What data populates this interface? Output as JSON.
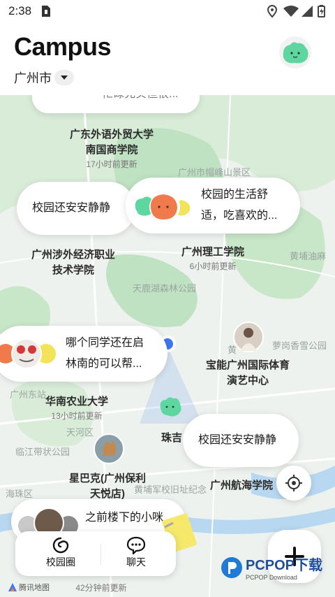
{
  "status": {
    "time": "2:38"
  },
  "header": {
    "title": "Campus",
    "city": "广州市"
  },
  "map": {
    "labels": [
      {
        "name": "area-label-baiyunshan",
        "text": "广州市帽峰山景区"
      },
      {
        "name": "area-label-huangpu",
        "text": "黄埔油麻"
      },
      {
        "name": "area-label-tianlu",
        "text": "天鹿湖森林公园"
      },
      {
        "name": "area-label-luogang",
        "text": "萝岗香雪公园"
      },
      {
        "name": "area-label-huangpu2",
        "text": "黄"
      },
      {
        "name": "area-label-dongzhan",
        "text": "广州东站"
      },
      {
        "name": "area-label-tianhe",
        "text": "天河区"
      },
      {
        "name": "area-label-linjiang",
        "text": "临江带状公园"
      },
      {
        "name": "area-label-haizhu",
        "text": "海珠区"
      },
      {
        "name": "area-label-huangpu-school",
        "text": "黄埔军校旧址纪念"
      }
    ],
    "schools": [
      {
        "name": "school-gdufs",
        "line1": "广东外语外贸大学",
        "line2": "南国商学院",
        "updated": "17小时前更新"
      },
      {
        "name": "school-gzist",
        "line1": "广州涉外经济职业",
        "line2": "技术学院",
        "updated": ""
      },
      {
        "name": "school-gzit",
        "line1": "广州理工学院",
        "line2": "",
        "updated": "6小时前更新"
      },
      {
        "name": "school-baoneng",
        "line1": "宝能广州国际体育",
        "line2": "演艺中心",
        "updated": ""
      },
      {
        "name": "school-scau",
        "line1": "华南农业大学",
        "line2": "",
        "updated": "13小时前更新"
      },
      {
        "name": "school-zhuji",
        "line1": "珠吉",
        "line2": "",
        "updated": ""
      },
      {
        "name": "school-starbucks",
        "line1": "星巴克(广州保利",
        "line2": "天悦店)",
        "updated": ""
      },
      {
        "name": "school-gzmu",
        "line1": "广州航海学院",
        "line2": "",
        "updated": ""
      },
      {
        "name": "school-bottom",
        "line1": "",
        "line2": "",
        "updated": "42分钟前更新"
      }
    ],
    "bubbles": {
      "top_partial": "忙碌充实但很...",
      "peace1": "校园还安安静静",
      "life_line1": "校园的生活舒",
      "life_line2": "适，吃喜欢的...",
      "classmate_line1": "哪个同学还在启",
      "classmate_line2": "林南的可以帮...",
      "peace2": "校园还安安静静",
      "cat": "之前楼下的小咪"
    },
    "attribution": "腾讯地图"
  },
  "nav": {
    "campus_label": "校园圈",
    "chat_label": "聊天"
  },
  "watermark": {
    "text": "PCPOP下载",
    "sub": "PCPOP Download"
  },
  "colors": {
    "green_avatar": "#5ed6a0",
    "orange_avatar": "#f07a4c",
    "yellow_avatar": "#f2e35a",
    "location_blue": "#3a78f2"
  }
}
